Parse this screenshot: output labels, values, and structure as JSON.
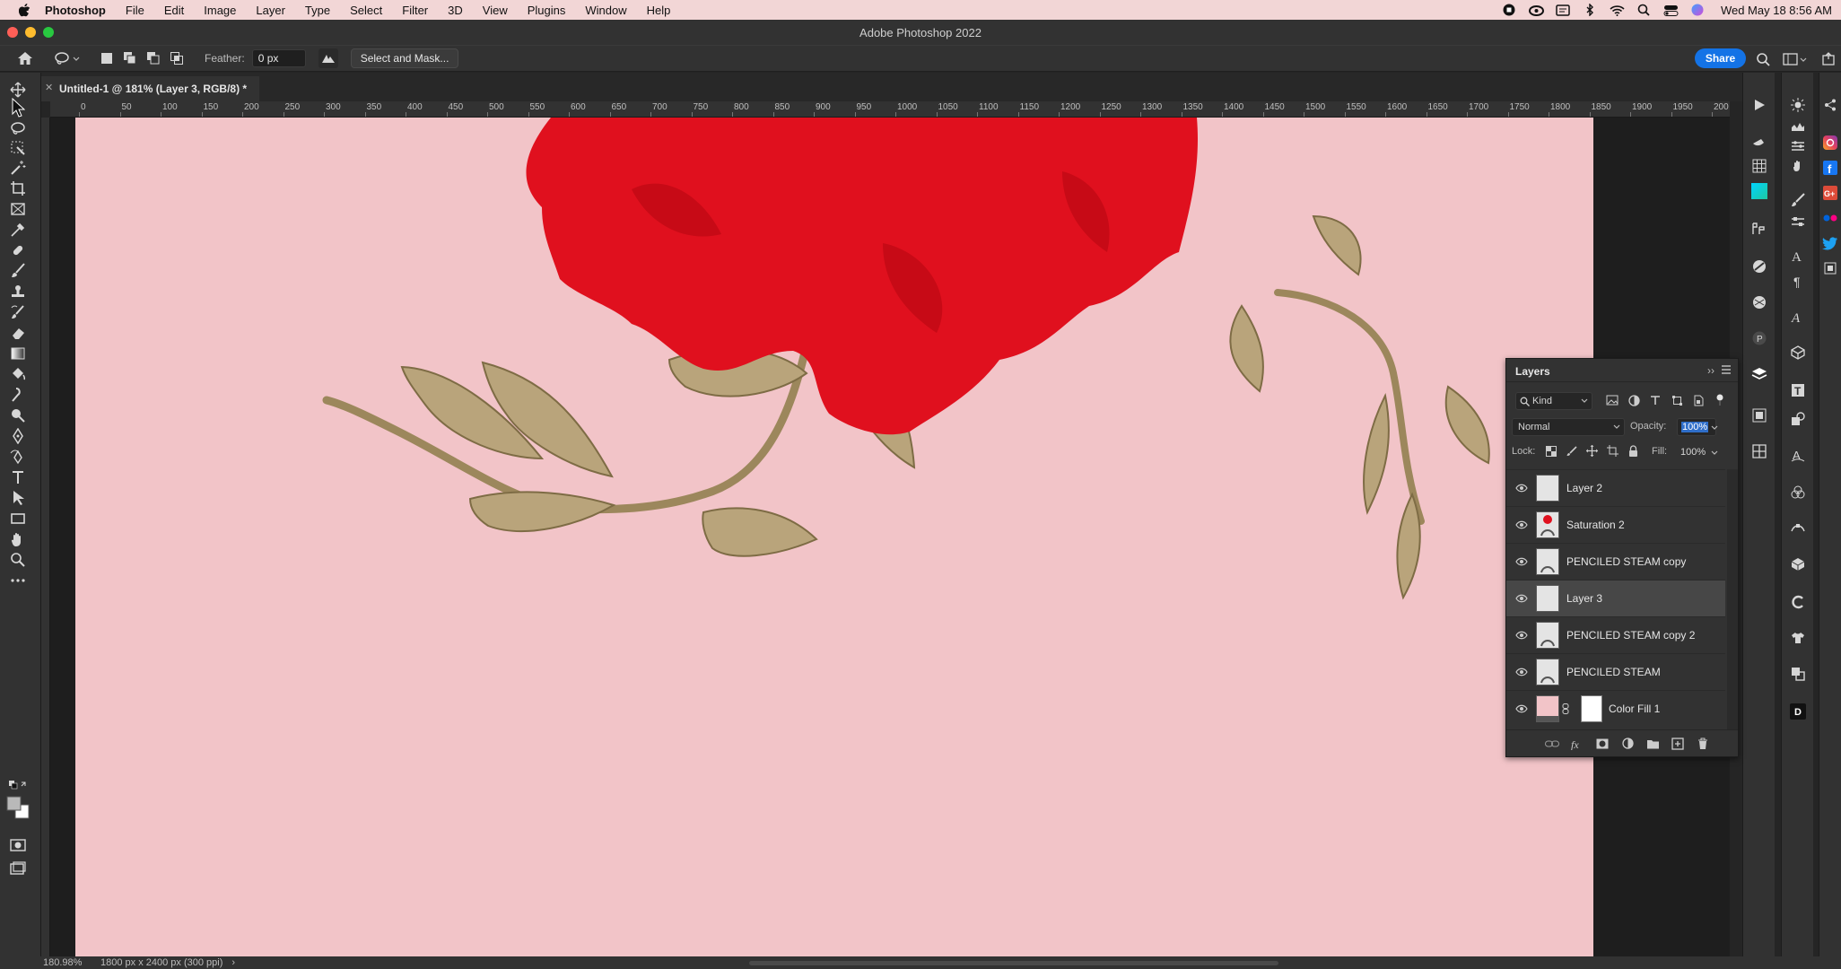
{
  "menubar": {
    "app_name": "Photoshop",
    "items": [
      "File",
      "Edit",
      "Image",
      "Layer",
      "Type",
      "Select",
      "Filter",
      "3D",
      "View",
      "Plugins",
      "Window",
      "Help"
    ],
    "clock": "Wed May 18  8:56 AM",
    "status_icons": [
      "record-icon",
      "creative-cloud-icon",
      "display-icon",
      "bluetooth-icon",
      "wifi-icon",
      "spotlight-search-icon",
      "control-center-icon",
      "siri-icon"
    ]
  },
  "window": {
    "title": "Adobe Photoshop 2022"
  },
  "options_bar": {
    "feather_label": "Feather:",
    "feather_value": "0 px",
    "select_and_mask": "Select and Mask...",
    "share": "Share"
  },
  "document": {
    "tab_title": "Untitled-1 @ 181% (Layer 3, RGB/8) *",
    "zoom": "180.98%",
    "doc_size": "1800 px x 2400 px (300 ppi)",
    "status_arrow": "›"
  },
  "ruler": {
    "labels": [
      "0",
      "50",
      "100",
      "150",
      "200",
      "250",
      "300",
      "350",
      "400",
      "450",
      "500",
      "550",
      "600",
      "650",
      "700",
      "750",
      "800",
      "850",
      "900",
      "950",
      "1000",
      "1050",
      "1100",
      "1150",
      "1200",
      "1250",
      "1300",
      "1350",
      "1400",
      "1450",
      "1500",
      "1550",
      "1600",
      "1650",
      "1700",
      "1750",
      "1800",
      "1850",
      "1900",
      "1950",
      "200"
    ]
  },
  "colors": {
    "canvas_fill": "#f2c4c8",
    "rose": "#e0101e",
    "leaves": "#a89266",
    "accent": "#1473e6"
  },
  "layers_panel": {
    "title": "Layers",
    "filter_kind": "Kind",
    "blend_mode": "Normal",
    "opacity_label": "Opacity:",
    "opacity_value": "100%",
    "lock_label": "Lock:",
    "fill_label": "Fill:",
    "fill_value": "100%",
    "layers": [
      {
        "name": "Layer 2",
        "visible": true,
        "selected": false
      },
      {
        "name": "Saturation 2",
        "visible": true,
        "selected": false
      },
      {
        "name": "PENCILED STEAM copy",
        "visible": true,
        "selected": false
      },
      {
        "name": "Layer 3",
        "visible": true,
        "selected": true
      },
      {
        "name": "PENCILED STEAM copy 2",
        "visible": true,
        "selected": false
      },
      {
        "name": "PENCILED STEAM",
        "visible": true,
        "selected": false
      },
      {
        "name": "Color Fill 1",
        "visible": true,
        "selected": false
      }
    ]
  }
}
